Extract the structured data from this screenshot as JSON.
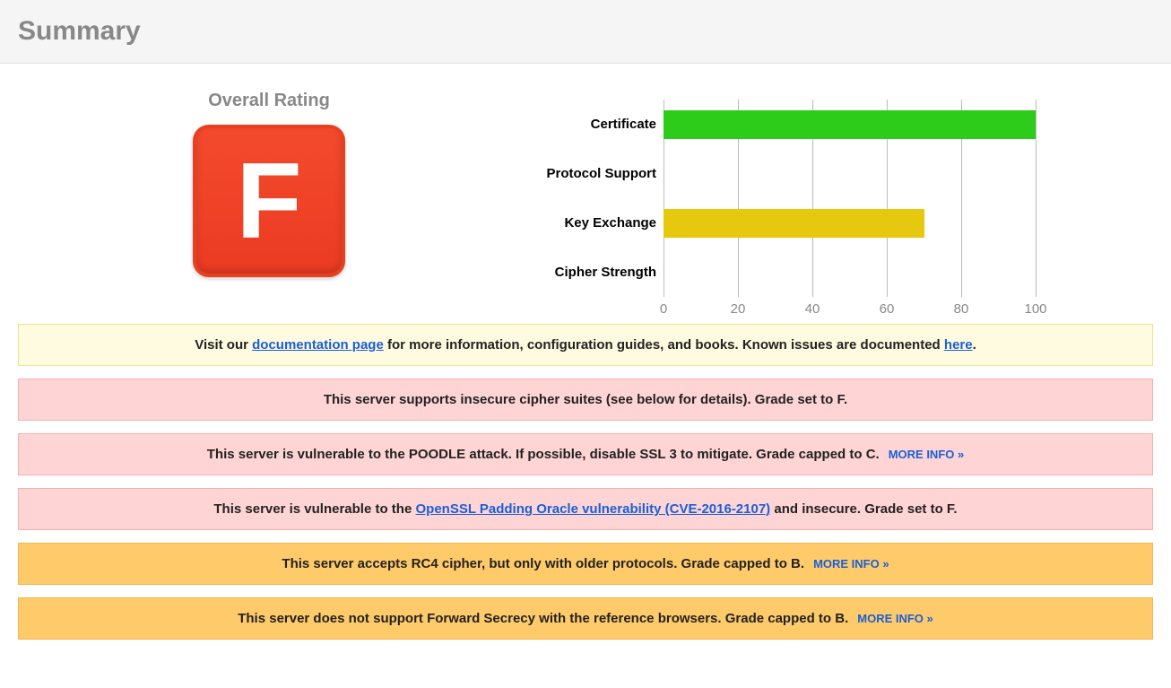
{
  "title": "Summary",
  "rating": {
    "label": "Overall Rating",
    "grade": "F"
  },
  "chart_data": {
    "type": "bar",
    "categories": [
      "Certificate",
      "Protocol Support",
      "Key Exchange",
      "Cipher Strength"
    ],
    "values": [
      100,
      0,
      70,
      0
    ],
    "colors": [
      "green",
      "none",
      "yellow",
      "none"
    ],
    "xlim": [
      0,
      100
    ],
    "ticks": [
      0,
      20,
      40,
      60,
      80,
      100
    ]
  },
  "notices": [
    {
      "type": "yellow",
      "parts": [
        {
          "text": "Visit our "
        },
        {
          "text": "documentation page",
          "link": true
        },
        {
          "text": " for more information, configuration guides, and books. Known issues are documented "
        },
        {
          "text": "here",
          "link": true
        },
        {
          "text": "."
        }
      ]
    },
    {
      "type": "red",
      "parts": [
        {
          "text": "This server supports insecure cipher suites (see below for details). Grade set to F."
        }
      ]
    },
    {
      "type": "red",
      "parts": [
        {
          "text": "This server is vulnerable to the POODLE attack. If possible, disable SSL 3 to mitigate. Grade capped to C."
        }
      ],
      "more_info": "MORE INFO »"
    },
    {
      "type": "red",
      "parts": [
        {
          "text": "This server is vulnerable to the "
        },
        {
          "text": "OpenSSL Padding Oracle vulnerability (CVE-2016-2107)",
          "link": true
        },
        {
          "text": " and insecure. Grade set to F."
        }
      ]
    },
    {
      "type": "orange",
      "parts": [
        {
          "text": "This server accepts RC4 cipher, but only with older protocols. Grade capped to B."
        }
      ],
      "more_info": "MORE INFO »"
    },
    {
      "type": "orange",
      "parts": [
        {
          "text": "This server does not support Forward Secrecy with the reference browsers. Grade capped to B."
        }
      ],
      "more_info": "MORE INFO »"
    }
  ]
}
